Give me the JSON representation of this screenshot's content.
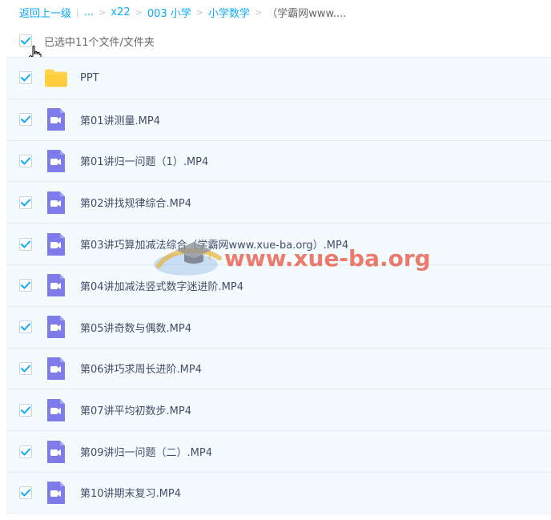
{
  "breadcrumb": {
    "back": "返回上一级",
    "sep": "|",
    "ellipsis": "...",
    "items": [
      "x22",
      "003 小学",
      "小学数学"
    ],
    "current": "（学霸网www....",
    "arrow": ">"
  },
  "selection": {
    "text": "已选中11个文件/文件夹",
    "checked": true
  },
  "colors": {
    "accent": "#09aaff",
    "checkbox_check": "#09aaff",
    "folder": "#ffd54f",
    "video_icon": "#7e7bea",
    "row_bg": "#f4fbff"
  },
  "files": [
    {
      "name": "PPT",
      "icon": "folder-icon",
      "checked": true
    },
    {
      "name": "第01讲测量.MP4",
      "icon": "video-icon",
      "checked": true
    },
    {
      "name": "第01讲归一问题（1）.MP4",
      "icon": "video-icon",
      "checked": true
    },
    {
      "name": "第02讲找规律综合.MP4",
      "icon": "video-icon",
      "checked": true
    },
    {
      "name": "第03讲巧算加减法综合（学霸网www.xue-ba.org）.MP4",
      "icon": "video-icon",
      "checked": true
    },
    {
      "name": "第04讲加减法竖式数字迷进阶.MP4",
      "icon": "video-icon",
      "checked": true
    },
    {
      "name": "第05讲奇数与偶数.MP4",
      "icon": "video-icon",
      "checked": true
    },
    {
      "name": "第06讲巧求周长进阶.MP4",
      "icon": "video-icon",
      "checked": true
    },
    {
      "name": "第07讲平均初数步.MP4",
      "icon": "video-icon",
      "checked": true
    },
    {
      "name": "第09讲归一问题（二）.MP4",
      "icon": "video-icon",
      "checked": true
    },
    {
      "name": "第10讲期末复习.MP4",
      "icon": "video-icon",
      "checked": true
    }
  ],
  "watermark": {
    "text": "www.xue-ba.org"
  }
}
